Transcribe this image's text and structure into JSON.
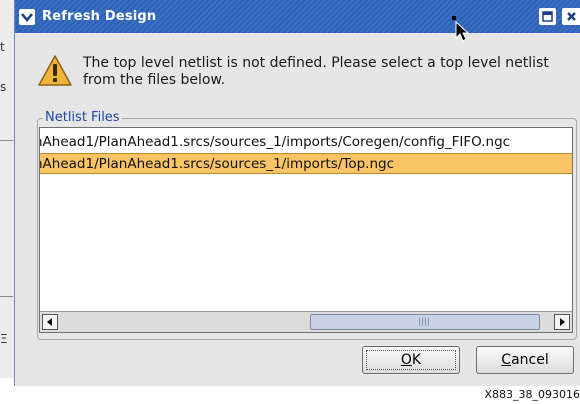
{
  "background": {
    "fragments": [
      "t",
      "s",
      "Ξ"
    ]
  },
  "window": {
    "title": "Refresh Design",
    "title_bar_color": "#3366b8"
  },
  "dialog": {
    "message": "The top level netlist is not defined. Please select a top level netlist from the files below.",
    "group_label": "Netlist Files",
    "netlist_files": [
      "nAhead1/PlanAhead1.srcs/sources_1/imports/Coregen/config_FIFO.ngc",
      "nAhead1/PlanAhead1.srcs/sources_1/imports/Top.ngc"
    ],
    "selected_index": 1,
    "selection_color": "#f8c465",
    "ok": {
      "accel": "O",
      "rest": "K"
    },
    "cancel": {
      "accel": "C",
      "rest": "ancel"
    }
  },
  "figure_id": "X883_38_093016"
}
